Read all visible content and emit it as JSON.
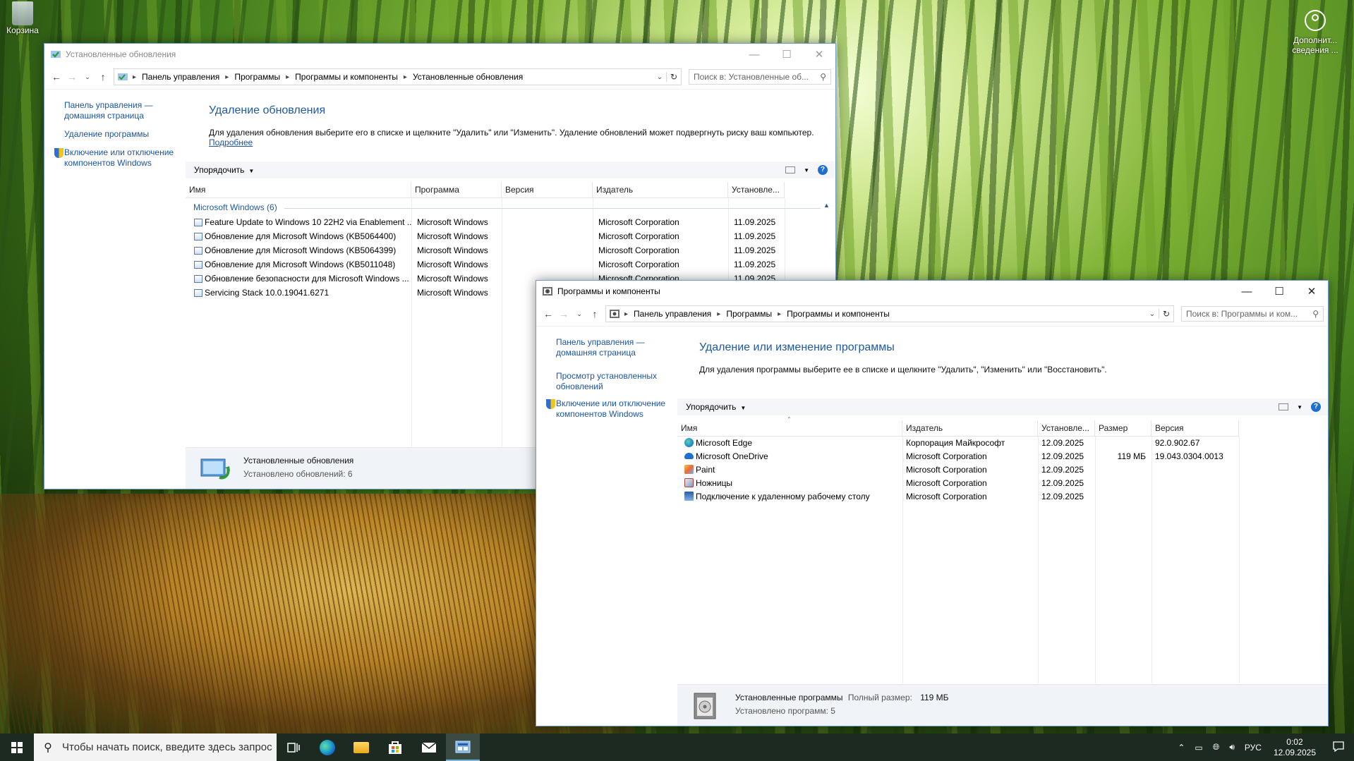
{
  "desktop": {
    "recycle_bin_label": "Корзина",
    "account_label_1": "Дополнит...",
    "account_label_2": "сведения ..."
  },
  "updates_window": {
    "title": "Установленные обновления",
    "breadcrumbs": [
      "Панель управления",
      "Программы",
      "Программы и компоненты",
      "Установленные обновления"
    ],
    "search_placeholder": "Поиск в: Установленные об...",
    "left_links": {
      "home": "Панель управления — домашняя страница",
      "uninstall": "Удаление программы",
      "features": "Включение или отключение компонентов Windows"
    },
    "heading": "Удаление обновления",
    "description": "Для удаления обновления выберите его в списке и щелкните \"Удалить\" или \"Изменить\". Удаление обновлений может подвергнуть риску ваш компьютер.",
    "more_link": "Подробнее",
    "organize": "Упорядочить",
    "columns": [
      "Имя",
      "Программа",
      "Версия",
      "Издатель",
      "Установле..."
    ],
    "group_label": "Microsoft Windows (6)",
    "rows": [
      {
        "name": "Feature Update to Windows 10 22H2 via Enablement ...",
        "program": "Microsoft Windows",
        "version": "",
        "publisher": "Microsoft Corporation",
        "installed": "11.09.2025"
      },
      {
        "name": "Обновление для Microsoft Windows (KB5064400)",
        "program": "Microsoft Windows",
        "version": "",
        "publisher": "Microsoft Corporation",
        "installed": "11.09.2025"
      },
      {
        "name": "Обновление для Microsoft Windows (KB5064399)",
        "program": "Microsoft Windows",
        "version": "",
        "publisher": "Microsoft Corporation",
        "installed": "11.09.2025"
      },
      {
        "name": "Обновление для Microsoft Windows (KB5011048)",
        "program": "Microsoft Windows",
        "version": "",
        "publisher": "Microsoft Corporation",
        "installed": "11.09.2025"
      },
      {
        "name": "Обновление безопасности для Microsoft Windows ...",
        "program": "Microsoft Windows",
        "version": "",
        "publisher": "Microsoft Corporation",
        "installed": "11.09.2025"
      },
      {
        "name": "Servicing Stack 10.0.19041.6271",
        "program": "Microsoft Windows",
        "version": "",
        "publisher": "",
        "installed": ""
      }
    ],
    "status_title": "Установленные обновления",
    "status_count": "Установлено обновлений: 6"
  },
  "programs_window": {
    "title": "Программы и компоненты",
    "breadcrumbs": [
      "Панель управления",
      "Программы",
      "Программы и компоненты"
    ],
    "search_placeholder": "Поиск в: Программы и ком...",
    "left_links": {
      "home": "Панель управления — домашняя страница",
      "view_updates": "Просмотр установленных обновлений",
      "features": "Включение или отключение компонентов Windows"
    },
    "heading": "Удаление или изменение программы",
    "description": "Для удаления программы выберите ее в списке и щелкните \"Удалить\", \"Изменить\" или \"Восстановить\".",
    "organize": "Упорядочить",
    "columns": [
      "Имя",
      "Издатель",
      "Установле...",
      "Размер",
      "Версия"
    ],
    "rows": [
      {
        "name": "Microsoft Edge",
        "icon": "edge-icon",
        "publisher": "Корпорация Майкрософт",
        "installed": "12.09.2025",
        "size": "",
        "version": "92.0.902.67"
      },
      {
        "name": "Microsoft OneDrive",
        "icon": "onedrive-icon",
        "publisher": "Microsoft Corporation",
        "installed": "12.09.2025",
        "size": "119 МБ",
        "version": "19.043.0304.0013"
      },
      {
        "name": "Paint",
        "icon": "paint-icon",
        "publisher": "Microsoft Corporation",
        "installed": "12.09.2025",
        "size": "",
        "version": ""
      },
      {
        "name": "Ножницы",
        "icon": "snipping-icon",
        "publisher": "Microsoft Corporation",
        "installed": "12.09.2025",
        "size": "",
        "version": ""
      },
      {
        "name": "Подключение к удаленному рабочему столу",
        "icon": "rdp-icon",
        "publisher": "Microsoft Corporation",
        "installed": "12.09.2025",
        "size": "",
        "version": ""
      }
    ],
    "status_title": "Установленные программы",
    "status_size_label": "Полный размер:",
    "status_size_value": "119 МБ",
    "status_count": "Установлено программ: 5"
  },
  "taskbar": {
    "search_placeholder": "Чтобы начать поиск, введите здесь запрос",
    "language": "РУС",
    "time": "0:02",
    "date": "12.09.2025"
  }
}
